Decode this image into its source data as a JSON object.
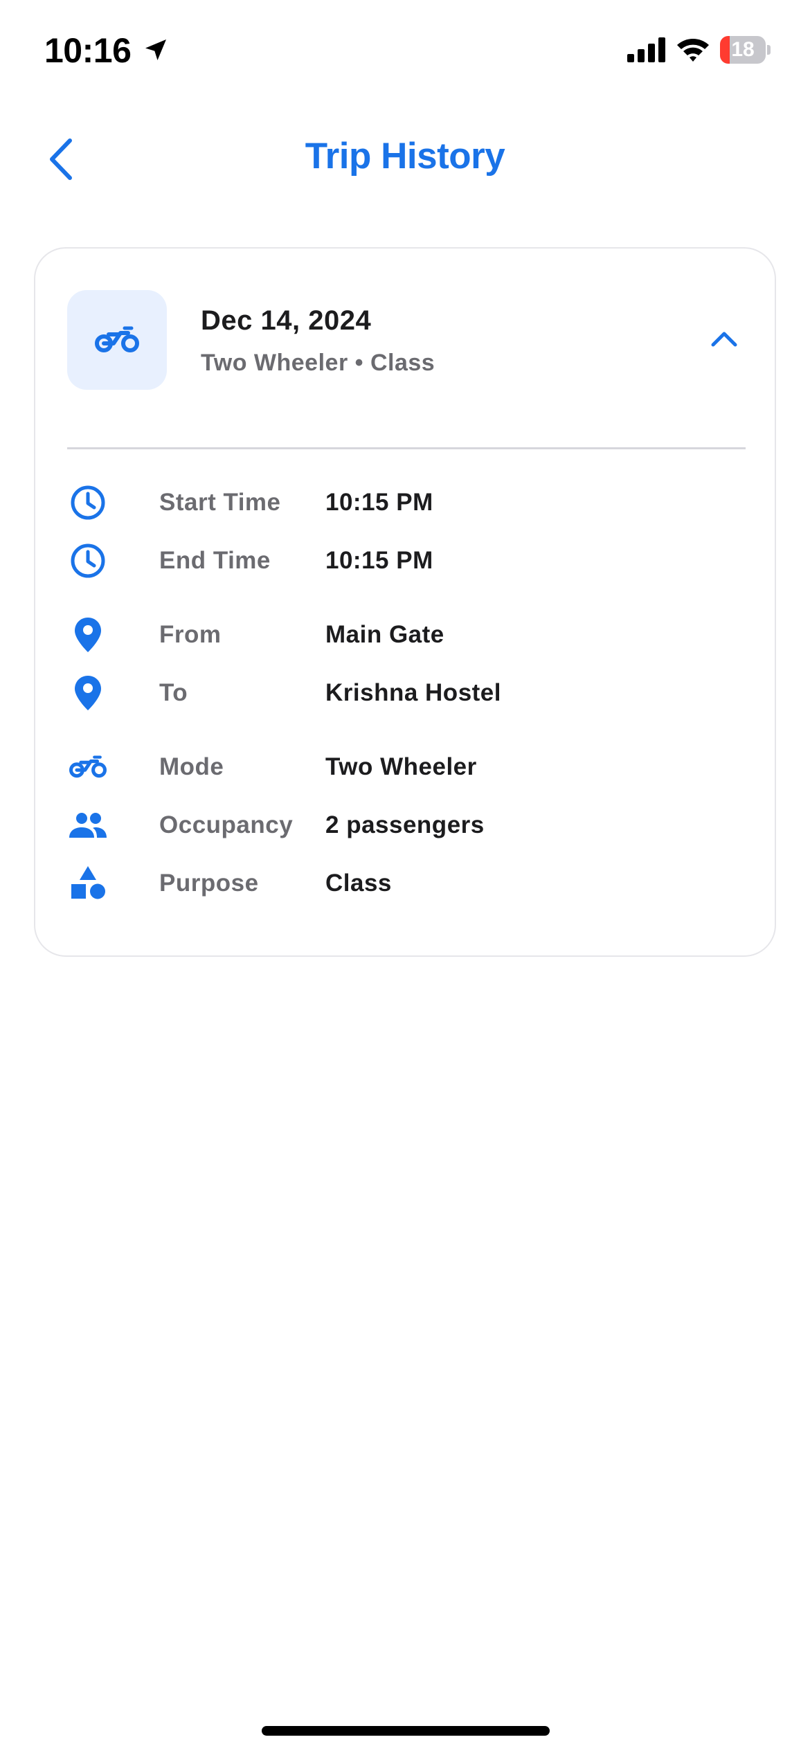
{
  "status_bar": {
    "time": "10:16",
    "battery": "18",
    "battery_low_color": "#ff3b30"
  },
  "header": {
    "title": "Trip History",
    "back_icon": "chevron-left-icon"
  },
  "colors": {
    "accent": "#1a73e8",
    "tile_bg": "#e8f0fe",
    "label_gray": "#6b6b70"
  },
  "trip": {
    "date": "Dec 14, 2024",
    "subtitle": "Two Wheeler • Class",
    "mode_icon": "motorcycle-icon",
    "expanded": true,
    "details": [
      {
        "label": "Start Time",
        "value": "10:15 PM",
        "icon": "clock-icon"
      },
      {
        "label": "End Time",
        "value": "10:15 PM",
        "icon": "clock-icon"
      },
      {
        "label": "From",
        "value": "Main Gate",
        "icon": "location-pin-icon"
      },
      {
        "label": "To",
        "value": "Krishna Hostel",
        "icon": "location-pin-icon"
      },
      {
        "label": "Mode",
        "value": "Two Wheeler",
        "icon": "motorcycle-icon"
      },
      {
        "label": "Occupancy",
        "value": "2 passengers",
        "icon": "people-icon"
      },
      {
        "label": "Purpose",
        "value": "Class",
        "icon": "shapes-icon"
      }
    ]
  }
}
